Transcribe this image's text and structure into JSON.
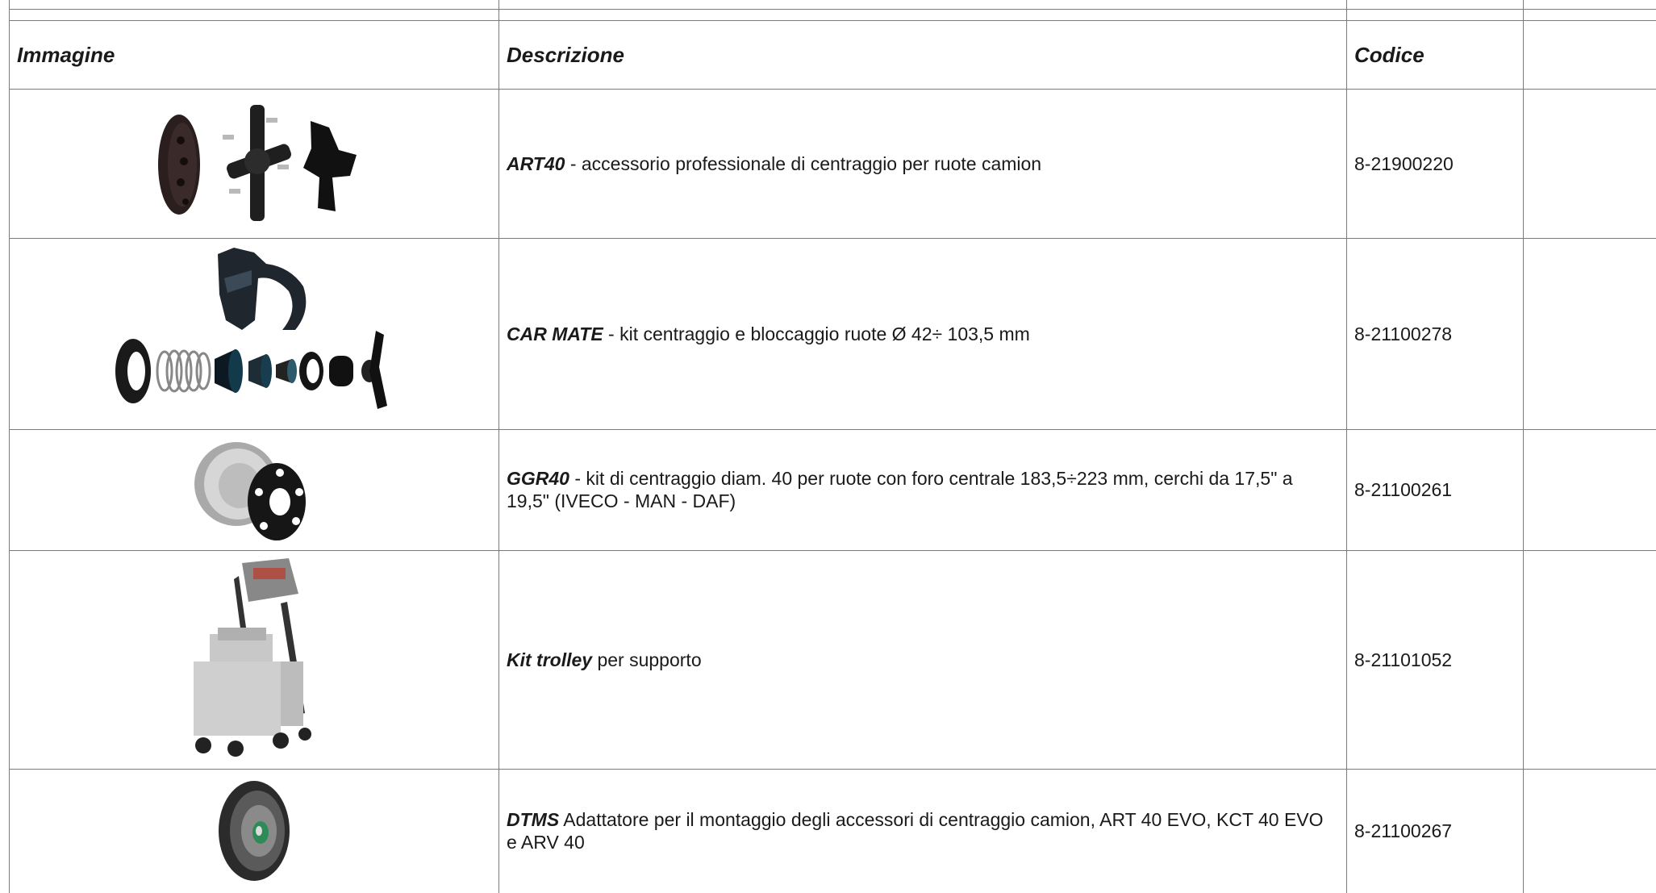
{
  "table": {
    "headers": {
      "image": "Immagine",
      "description": "Descrizione",
      "code": "Codice",
      "extra": ""
    },
    "rows": [
      {
        "product": "ART40",
        "description": " - accessorio professionale di centraggio per ruote camion",
        "code": "8-21900220",
        "image_icon": "centering-accessory-set-icon"
      },
      {
        "product": "CAR MATE",
        "description": " - kit centraggio e bloccaggio ruote Ø 42÷ 103,5 mm",
        "code": "8-21100278",
        "image_icon": "cone-kit-icon"
      },
      {
        "product": "GGR40",
        "description": " - kit di centraggio diam. 40 per ruote con foro centrale 183,5÷223 mm, cerchi da 17,5\" a 19,5\" (IVECO - MAN - DAF)",
        "code": "8-21100261",
        "image_icon": "centering-bell-icon"
      },
      {
        "product": "Kit trolley",
        "description": " per supporto",
        "code": "8-21101052",
        "image_icon": "trolley-icon"
      },
      {
        "product": "DTMS",
        "description": " Adattatore per il montaggio degli accessori di centraggio camion, ART 40 EVO, KCT 40 EVO e ARV 40",
        "code": "8-21100267",
        "image_icon": "adapter-disc-icon"
      }
    ]
  },
  "colors": {
    "border": "#7a7a7a",
    "text": "#1a1a1a",
    "background": "#ffffff"
  }
}
